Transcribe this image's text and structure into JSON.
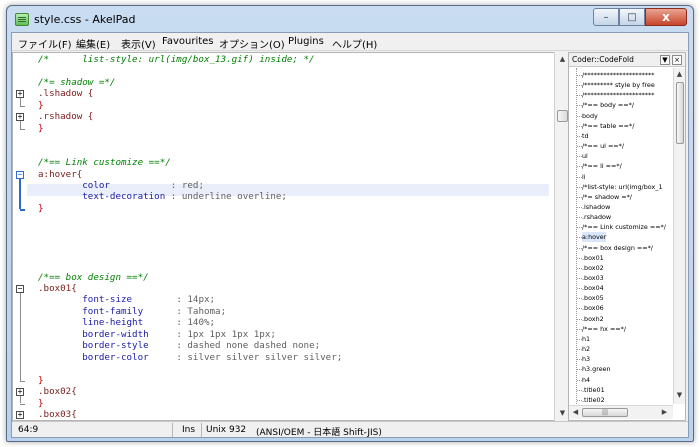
{
  "window": {
    "title": "style.css - AkelPad"
  },
  "caption_buttons": {
    "minimize": "–",
    "maximize": "□",
    "close": "x"
  },
  "menu": [
    "ファイル(F)",
    "編集(E)",
    "表示(V)",
    "Favourites",
    "オプション(O)",
    "Plugins",
    "ヘルプ(H)"
  ],
  "editor": {
    "lines": [
      {
        "t": "comment",
        "text": "/*      list-style: url(img/box_13.gif) inside; */"
      },
      {
        "t": "blank",
        "text": ""
      },
      {
        "t": "comment",
        "text": "/*= shadow =*/"
      },
      {
        "t": "sel",
        "text": ".lshadow {"
      },
      {
        "t": "brace",
        "text": "}"
      },
      {
        "t": "sel",
        "text": ".rshadow {"
      },
      {
        "t": "brace",
        "text": "}"
      },
      {
        "t": "blank",
        "text": ""
      },
      {
        "t": "blank",
        "text": ""
      },
      {
        "t": "comment",
        "text": "/*== Link customize ==*/"
      },
      {
        "t": "sel",
        "text": "a:hover{"
      },
      {
        "t": "decl",
        "prop": "color",
        "pad": "           ",
        "val": ": red;"
      },
      {
        "t": "decl",
        "prop": "text-decoration",
        "pad": " ",
        "val": ": underline overline;"
      },
      {
        "t": "brace",
        "text": "}"
      },
      {
        "t": "blank",
        "text": ""
      },
      {
        "t": "blank",
        "text": ""
      },
      {
        "t": "blank",
        "text": ""
      },
      {
        "t": "blank",
        "text": ""
      },
      {
        "t": "blank",
        "text": ""
      },
      {
        "t": "comment",
        "text": "/*== box design ==*/"
      },
      {
        "t": "sel",
        "text": ".box01{"
      },
      {
        "t": "decl",
        "prop": "font-size",
        "pad": "        ",
        "val": ": 14px;"
      },
      {
        "t": "decl",
        "prop": "font-family",
        "pad": "      ",
        "val": ": Tahoma;"
      },
      {
        "t": "decl",
        "prop": "line-height",
        "pad": "      ",
        "val": ": 140%;"
      },
      {
        "t": "decl",
        "prop": "border-width",
        "pad": "     ",
        "val": ": 1px 1px 1px 1px;"
      },
      {
        "t": "decl",
        "prop": "border-style",
        "pad": "     ",
        "val": ": dashed none dashed none;"
      },
      {
        "t": "decl",
        "prop": "border-color",
        "pad": "     ",
        "val": ": silver silver silver silver;"
      },
      {
        "t": "blank",
        "text": ""
      },
      {
        "t": "brace",
        "text": "}"
      },
      {
        "t": "sel",
        "text": ".box02{"
      },
      {
        "t": "brace",
        "text": "}"
      },
      {
        "t": "sel",
        "text": ".box03{"
      }
    ]
  },
  "panel": {
    "title": "Coder::CodeFold",
    "dropdown_icon": "▼",
    "close_icon": "×",
    "items": [
      "/**********************",
      "/********* style by free",
      "/**********************",
      "/*== body ==*/",
      "body",
      "/*== table ==*/",
      "td",
      "/*== ul ==*/",
      "ul",
      "/*== li ==*/",
      "li",
      "/*list-style: url(img/box_1",
      "/*= shadow =*/",
      ".lshadow",
      ".rshadow",
      "/*== Link customize ==*/",
      "a:hover",
      "/*== box design ==*/",
      ".box01",
      ".box02",
      ".box03",
      ".box04",
      ".box05",
      ".box06",
      ".boxh2",
      "/*== hx ==*/",
      "h1",
      "h2",
      "h3",
      "h3.green",
      "h4",
      ".title01",
      ".title02"
    ],
    "selected_index": 16,
    "hscroll_label": "|||"
  },
  "status": {
    "position": "64:9",
    "insert_mode": "Ins",
    "newline": "Unix 932",
    "encoding": "(ANSI/OEM - 日本語 Shift-JIS)"
  },
  "colors": {
    "comment": "#008000",
    "selector": "#7b1c1c",
    "property": "#1a1aa8",
    "value": "#606060",
    "brace": "#c00000",
    "current_line": "#eaeefb"
  }
}
